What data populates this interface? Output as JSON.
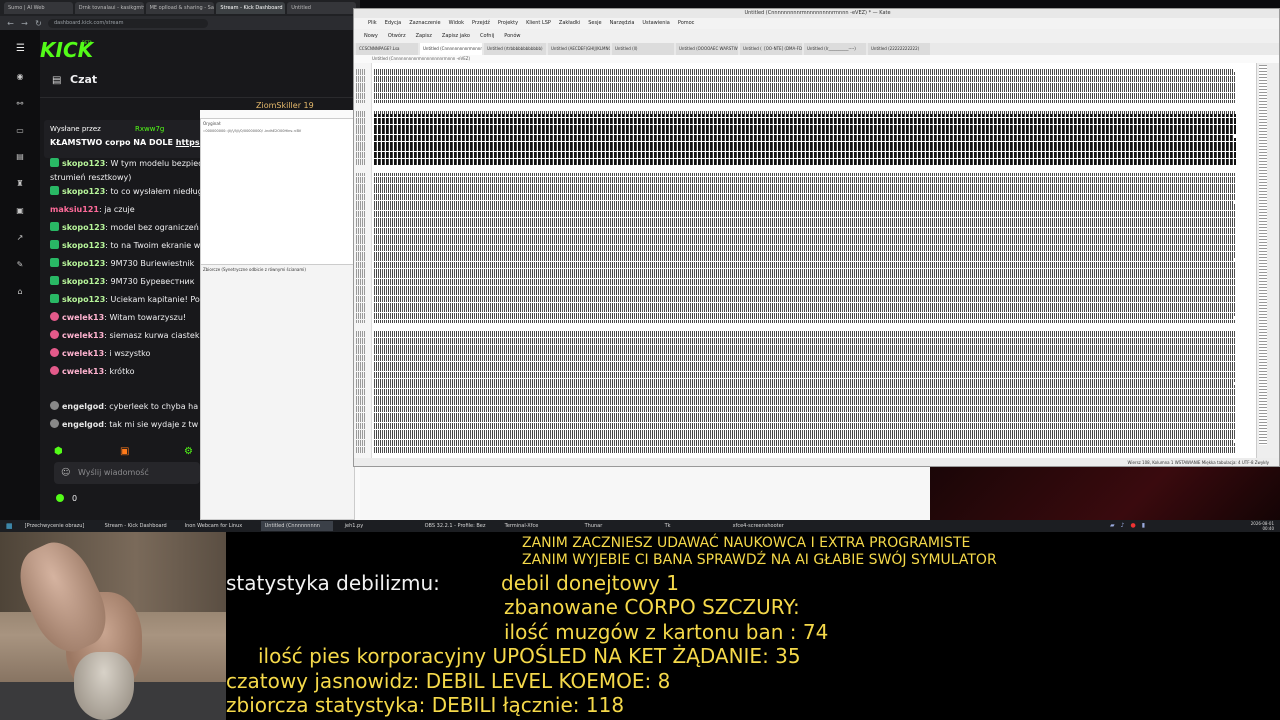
{
  "browser": {
    "tabs": [
      "Sumo | AI Web",
      "Drnk tovnalaui - kasikgmtv",
      "ME oplload & sharing - Sav",
      "Stream - Kick Dashboard",
      "Untitled"
    ],
    "url": "dashboard.kick.com/stream"
  },
  "kick": {
    "logo": "KICK",
    "beta": "BETA",
    "chat_title": "Czat",
    "top_user": "ZiomSkiller 19",
    "pinned": {
      "header": "Wysłane przez",
      "user": "Rxww7g",
      "text": "KŁAMSTWO corpo NA DOLE ",
      "link": "https://sh"
    },
    "messages": [
      {
        "user": "skopo123",
        "text": "W tym modelu bezpiecze",
        "badge": "green"
      },
      {
        "user": "",
        "text": "strumień resztkowy)",
        "badge": "none"
      },
      {
        "user": "skopo123",
        "text": "to co wysłałem niedługo z",
        "badge": "green"
      },
      {
        "user": "maksiu121",
        "text": "ja czuje",
        "badge": "none"
      },
      {
        "user": "skopo123",
        "text": "model bez ograniczeń - w",
        "badge": "green"
      },
      {
        "user": "skopo123",
        "text": "to na Twoim ekranie wygl",
        "badge": "green"
      },
      {
        "user": "skopo123",
        "text": "9M730 Buriewiestnik",
        "badge": "green"
      },
      {
        "user": "skopo123",
        "text": "9M730 Буревестник",
        "badge": "green"
      },
      {
        "user": "skopo123",
        "text": "Uciekam kapitanie! Powo",
        "badge": "green"
      },
      {
        "user": "cwelek13",
        "text": "Witam towarzyszu!",
        "badge": "pink"
      },
      {
        "user": "cwelek13",
        "text": "siemasz kurwa ciastek ko",
        "badge": "pink"
      },
      {
        "user": "cwelek13",
        "text": "i wszystko",
        "badge": "pink"
      },
      {
        "user": "cwelek13",
        "text": "krótko",
        "badge": "pink"
      },
      {
        "user": "engelgod",
        "text": "cyberleek to chyba ha",
        "badge": "gray"
      },
      {
        "user": "engelgod",
        "text": "tak mi sie wydaje z tw",
        "badge": "gray"
      }
    ],
    "input_placeholder": "Wyślij wiadomość",
    "points": "0"
  },
  "side_windows": {
    "original_title": "Oryginał:",
    "original_line": "::000000000::|I\\/\\/I\\/\\/0/00000000/ -indhE2O00Hlnv-<BV",
    "collection_title": "Zbiorcze (Synetryczne odbicie z równymi ścianami)"
  },
  "kate": {
    "title": "Untitled (Cnnnnnnnnnrmnnnnnnnnrrnnnn -eVEZ) * — Kate",
    "menu": [
      "Plik",
      "Edycja",
      "Zaznaczenie",
      "Widok",
      "Przejdź",
      "Projekty",
      "Klient LSP",
      "Zakładki",
      "Sesje",
      "Narzędzia",
      "Ustawienia",
      "Pomoc"
    ],
    "toolbar": [
      "Nowy",
      "Otwórz",
      "Zapisz",
      "Zapisz jako",
      "Cofnij",
      "Ponów"
    ],
    "tabs": [
      "CCSCNNNPAGE?.Lsa",
      "Untitled (Cnnnnnnnnnrmnnnnn -HRAS)",
      "Untitled (rtrbbbbbbbbbbbb)",
      "Untitled (AECDEF(GHIJ)KLMNOPQRSTUVWXYZ)",
      "Untitled (ll)",
      "Untitled (OOOOAEC WARSTWE)",
      "Untitled (  [OO-NTE] (DMA‑FD‑L))",
      "Untitled (Ir__________----)",
      "Untitled (22222222222)"
    ],
    "crumb": "Untitled (Cnnnnnnnnnrmnnnnnnnnrrnnnn -eVEZ)",
    "status": "Wiersz 108, Kolumna 1   WSTAWIANIE   Miękka tabulacja: 4   UTF-8   Zwykły"
  },
  "taskbar": {
    "items": [
      "[Przechwycenie obrazu]",
      "Stream - Kick Dashboard",
      "Inon Webcam for Linux",
      "Untitled (Cnnnnnnnnn",
      "jeh1.py",
      "OBS 32.2.1 - Profile: Bez",
      "Terminal-Xfce",
      "Thunar",
      "Tk",
      "xfce4-screenshooter"
    ],
    "clock_time": "00:40",
    "clock_date": "2026-08-01"
  },
  "overlay": {
    "headline1": "ZANIM ZACZNIESZ UDAWAĆ NAUKOWCA I EXTRA PROGRAMISTE",
    "headline2": "ZANIM WYJEBIE CI BANA SPRAWDŹ NA AI GŁABIE SWÓJ SYMULATOR",
    "stats_label": "statystyka debilizmu:",
    "line1_label": "debil donejtowy",
    "line1_value": "1",
    "line2_label": "zbanowane CORPO SZCZURY:",
    "line3_label": "ilość muzgów z kartonu ban :",
    "line3_value": "74",
    "line4_label": "ilość pies korporacyjny UPOŚLED NA KET ŻĄDANIE:",
    "line4_value": "35",
    "line5_label": "czatowy jasnowidz: DEBIL LEVEL KOEMOE:",
    "line5_value": "8",
    "line6_label": "zbiorcza statystyka: DEBILI łącznie:",
    "line6_value": "118"
  }
}
